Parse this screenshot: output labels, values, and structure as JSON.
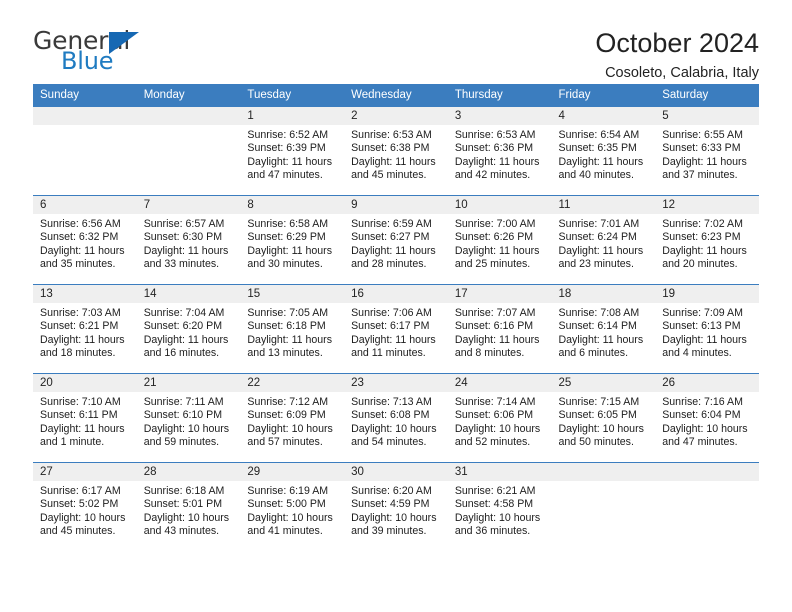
{
  "brand": {
    "name_top": "General",
    "name_bottom": "Blue",
    "accent_color": "#1668b3",
    "text_color": "#3a3a3a"
  },
  "header": {
    "title": "October 2024",
    "subtitle": "Cosoleto, Calabria, Italy"
  },
  "calendar": {
    "header_bg": "#3b7dbf",
    "header_text_color": "#ffffff",
    "daynum_bg": "#efefef",
    "weekday_labels": [
      "Sunday",
      "Monday",
      "Tuesday",
      "Wednesday",
      "Thursday",
      "Friday",
      "Saturday"
    ],
    "weeks": [
      [
        {
          "day": "",
          "blank": true
        },
        {
          "day": "",
          "blank": true
        },
        {
          "day": "1",
          "sunrise": "Sunrise: 6:52 AM",
          "sunset": "Sunset: 6:39 PM",
          "daylight": "Daylight: 11 hours and 47 minutes."
        },
        {
          "day": "2",
          "sunrise": "Sunrise: 6:53 AM",
          "sunset": "Sunset: 6:38 PM",
          "daylight": "Daylight: 11 hours and 45 minutes."
        },
        {
          "day": "3",
          "sunrise": "Sunrise: 6:53 AM",
          "sunset": "Sunset: 6:36 PM",
          "daylight": "Daylight: 11 hours and 42 minutes."
        },
        {
          "day": "4",
          "sunrise": "Sunrise: 6:54 AM",
          "sunset": "Sunset: 6:35 PM",
          "daylight": "Daylight: 11 hours and 40 minutes."
        },
        {
          "day": "5",
          "sunrise": "Sunrise: 6:55 AM",
          "sunset": "Sunset: 6:33 PM",
          "daylight": "Daylight: 11 hours and 37 minutes."
        }
      ],
      [
        {
          "day": "6",
          "sunrise": "Sunrise: 6:56 AM",
          "sunset": "Sunset: 6:32 PM",
          "daylight": "Daylight: 11 hours and 35 minutes."
        },
        {
          "day": "7",
          "sunrise": "Sunrise: 6:57 AM",
          "sunset": "Sunset: 6:30 PM",
          "daylight": "Daylight: 11 hours and 33 minutes."
        },
        {
          "day": "8",
          "sunrise": "Sunrise: 6:58 AM",
          "sunset": "Sunset: 6:29 PM",
          "daylight": "Daylight: 11 hours and 30 minutes."
        },
        {
          "day": "9",
          "sunrise": "Sunrise: 6:59 AM",
          "sunset": "Sunset: 6:27 PM",
          "daylight": "Daylight: 11 hours and 28 minutes."
        },
        {
          "day": "10",
          "sunrise": "Sunrise: 7:00 AM",
          "sunset": "Sunset: 6:26 PM",
          "daylight": "Daylight: 11 hours and 25 minutes."
        },
        {
          "day": "11",
          "sunrise": "Sunrise: 7:01 AM",
          "sunset": "Sunset: 6:24 PM",
          "daylight": "Daylight: 11 hours and 23 minutes."
        },
        {
          "day": "12",
          "sunrise": "Sunrise: 7:02 AM",
          "sunset": "Sunset: 6:23 PM",
          "daylight": "Daylight: 11 hours and 20 minutes."
        }
      ],
      [
        {
          "day": "13",
          "sunrise": "Sunrise: 7:03 AM",
          "sunset": "Sunset: 6:21 PM",
          "daylight": "Daylight: 11 hours and 18 minutes."
        },
        {
          "day": "14",
          "sunrise": "Sunrise: 7:04 AM",
          "sunset": "Sunset: 6:20 PM",
          "daylight": "Daylight: 11 hours and 16 minutes."
        },
        {
          "day": "15",
          "sunrise": "Sunrise: 7:05 AM",
          "sunset": "Sunset: 6:18 PM",
          "daylight": "Daylight: 11 hours and 13 minutes."
        },
        {
          "day": "16",
          "sunrise": "Sunrise: 7:06 AM",
          "sunset": "Sunset: 6:17 PM",
          "daylight": "Daylight: 11 hours and 11 minutes."
        },
        {
          "day": "17",
          "sunrise": "Sunrise: 7:07 AM",
          "sunset": "Sunset: 6:16 PM",
          "daylight": "Daylight: 11 hours and 8 minutes."
        },
        {
          "day": "18",
          "sunrise": "Sunrise: 7:08 AM",
          "sunset": "Sunset: 6:14 PM",
          "daylight": "Daylight: 11 hours and 6 minutes."
        },
        {
          "day": "19",
          "sunrise": "Sunrise: 7:09 AM",
          "sunset": "Sunset: 6:13 PM",
          "daylight": "Daylight: 11 hours and 4 minutes."
        }
      ],
      [
        {
          "day": "20",
          "sunrise": "Sunrise: 7:10 AM",
          "sunset": "Sunset: 6:11 PM",
          "daylight": "Daylight: 11 hours and 1 minute."
        },
        {
          "day": "21",
          "sunrise": "Sunrise: 7:11 AM",
          "sunset": "Sunset: 6:10 PM",
          "daylight": "Daylight: 10 hours and 59 minutes."
        },
        {
          "day": "22",
          "sunrise": "Sunrise: 7:12 AM",
          "sunset": "Sunset: 6:09 PM",
          "daylight": "Daylight: 10 hours and 57 minutes."
        },
        {
          "day": "23",
          "sunrise": "Sunrise: 7:13 AM",
          "sunset": "Sunset: 6:08 PM",
          "daylight": "Daylight: 10 hours and 54 minutes."
        },
        {
          "day": "24",
          "sunrise": "Sunrise: 7:14 AM",
          "sunset": "Sunset: 6:06 PM",
          "daylight": "Daylight: 10 hours and 52 minutes."
        },
        {
          "day": "25",
          "sunrise": "Sunrise: 7:15 AM",
          "sunset": "Sunset: 6:05 PM",
          "daylight": "Daylight: 10 hours and 50 minutes."
        },
        {
          "day": "26",
          "sunrise": "Sunrise: 7:16 AM",
          "sunset": "Sunset: 6:04 PM",
          "daylight": "Daylight: 10 hours and 47 minutes."
        }
      ],
      [
        {
          "day": "27",
          "sunrise": "Sunrise: 6:17 AM",
          "sunset": "Sunset: 5:02 PM",
          "daylight": "Daylight: 10 hours and 45 minutes."
        },
        {
          "day": "28",
          "sunrise": "Sunrise: 6:18 AM",
          "sunset": "Sunset: 5:01 PM",
          "daylight": "Daylight: 10 hours and 43 minutes."
        },
        {
          "day": "29",
          "sunrise": "Sunrise: 6:19 AM",
          "sunset": "Sunset: 5:00 PM",
          "daylight": "Daylight: 10 hours and 41 minutes."
        },
        {
          "day": "30",
          "sunrise": "Sunrise: 6:20 AM",
          "sunset": "Sunset: 4:59 PM",
          "daylight": "Daylight: 10 hours and 39 minutes."
        },
        {
          "day": "31",
          "sunrise": "Sunrise: 6:21 AM",
          "sunset": "Sunset: 4:58 PM",
          "daylight": "Daylight: 10 hours and 36 minutes."
        },
        {
          "day": "",
          "blank": true
        },
        {
          "day": "",
          "blank": true
        }
      ]
    ]
  }
}
